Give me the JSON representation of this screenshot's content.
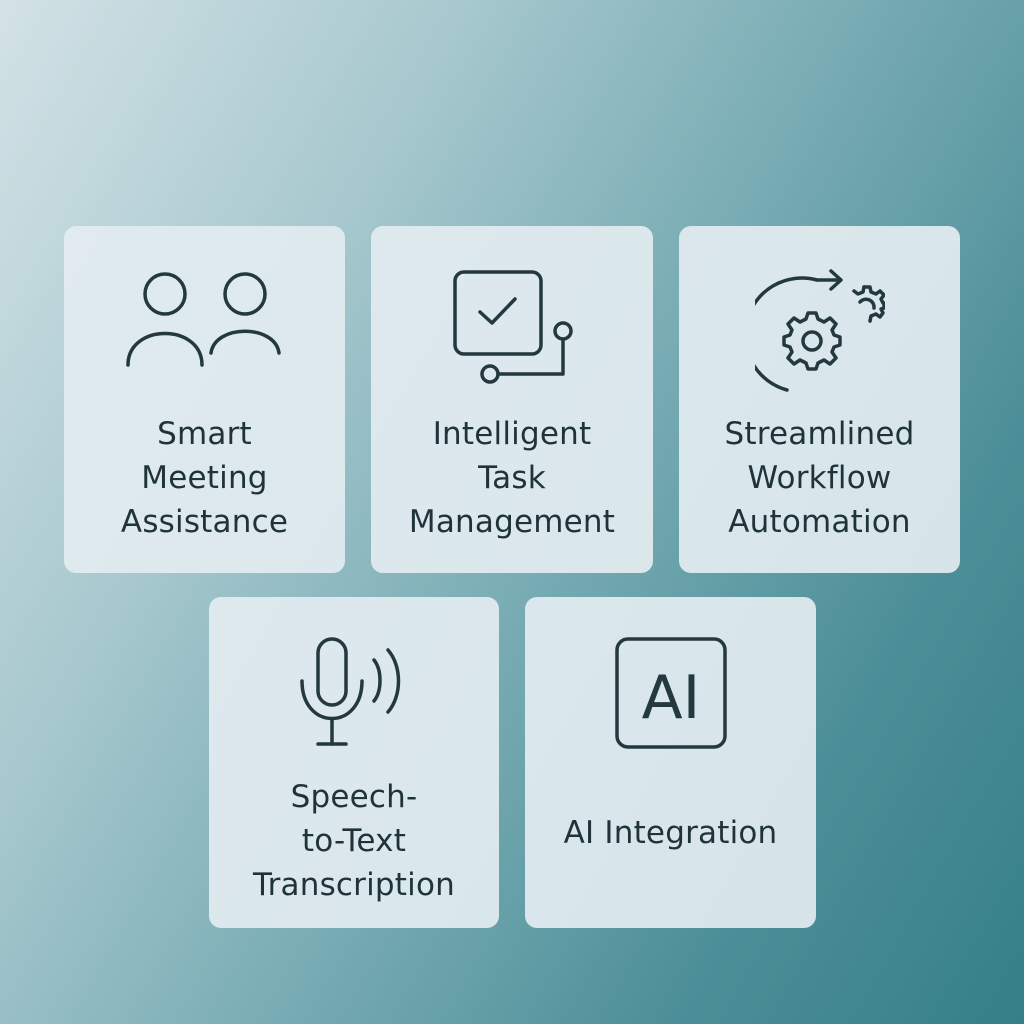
{
  "cards": [
    {
      "icon": "people-icon",
      "lines": [
        "Smart",
        "Meeting",
        "Assistance"
      ]
    },
    {
      "icon": "task-checkbox-icon",
      "lines": [
        "Intelligent",
        "Task",
        "Management"
      ]
    },
    {
      "icon": "gear-cycle-icon",
      "lines": [
        "Streamlined",
        "Workflow",
        "Automation"
      ]
    },
    {
      "icon": "microphone-icon",
      "lines": [
        "Speech-",
        "to-Text",
        "Transcription"
      ]
    },
    {
      "icon": "ai-badge-icon",
      "badge_text": "AI",
      "lines": [
        "AI Integration"
      ]
    }
  ],
  "colors": {
    "icon_stroke": "#23393e",
    "text": "#1f3439",
    "card_bg": "#e2ecf0",
    "bg_light": "#d3e2e6",
    "bg_dark": "#357f88"
  }
}
